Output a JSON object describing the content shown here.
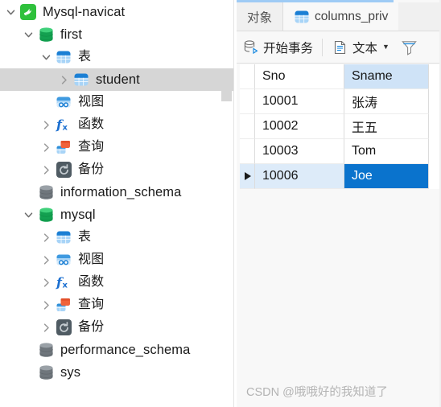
{
  "colors": {
    "selection_blue": "#0a73cd",
    "row_selected_blue": "#ddebf9",
    "header_col_blue": "#cfe3f7",
    "tree_selected_gray": "#d6d6d6",
    "accent_line": "#9ecbf5",
    "mysql_green": "#2fc13c",
    "db_open_green": "#18a04a",
    "db_closed_gray": "#6f767c",
    "table_icon_blue": "#1b7fd4",
    "query_icon_orange": "#f0623a",
    "backup_icon_gray": "#4f5b63"
  },
  "tree": {
    "nodes": [
      {
        "label": "Mysql-navicat",
        "icon": "mysql-dolphin-icon",
        "level": 0,
        "twisty": "down",
        "selected": false,
        "cjk": false
      },
      {
        "label": "first",
        "icon": "database-open-icon",
        "level": 1,
        "twisty": "down",
        "selected": false,
        "cjk": false
      },
      {
        "label": "表",
        "icon": "table-icon",
        "level": 2,
        "twisty": "down",
        "selected": false,
        "cjk": true
      },
      {
        "label": "student",
        "icon": "table-icon",
        "level": 3,
        "twisty": "right",
        "selected": true,
        "cjk": false
      },
      {
        "label": "视图",
        "icon": "view-icon",
        "level": 2,
        "twisty": "none",
        "selected": false,
        "cjk": true
      },
      {
        "label": "函数",
        "icon": "function-icon",
        "level": 2,
        "twisty": "right",
        "selected": false,
        "cjk": true
      },
      {
        "label": "查询",
        "icon": "query-icon",
        "level": 2,
        "twisty": "right",
        "selected": false,
        "cjk": true
      },
      {
        "label": "备份",
        "icon": "backup-icon",
        "level": 2,
        "twisty": "right",
        "selected": false,
        "cjk": true
      },
      {
        "label": "information_schema",
        "icon": "database-closed-icon",
        "level": 1,
        "twisty": "none",
        "selected": false,
        "cjk": false
      },
      {
        "label": "mysql",
        "icon": "database-open-icon",
        "level": 1,
        "twisty": "down",
        "selected": false,
        "cjk": false
      },
      {
        "label": "表",
        "icon": "table-icon",
        "level": 2,
        "twisty": "right",
        "selected": false,
        "cjk": true
      },
      {
        "label": "视图",
        "icon": "view-icon",
        "level": 2,
        "twisty": "right",
        "selected": false,
        "cjk": true
      },
      {
        "label": "函数",
        "icon": "function-icon",
        "level": 2,
        "twisty": "right",
        "selected": false,
        "cjk": true
      },
      {
        "label": "查询",
        "icon": "query-icon",
        "level": 2,
        "twisty": "right",
        "selected": false,
        "cjk": true
      },
      {
        "label": "备份",
        "icon": "backup-icon",
        "level": 2,
        "twisty": "right",
        "selected": false,
        "cjk": true
      },
      {
        "label": "performance_schema",
        "icon": "database-closed-icon",
        "level": 1,
        "twisty": "none",
        "selected": false,
        "cjk": false
      },
      {
        "label": "sys",
        "icon": "database-closed-icon",
        "level": 1,
        "twisty": "none",
        "selected": false,
        "cjk": false
      }
    ]
  },
  "tabs": [
    {
      "label": "对象",
      "icon": "none",
      "active": false
    },
    {
      "label": "columns_priv",
      "icon": "table-icon",
      "active": true
    }
  ],
  "toolbar": {
    "begin_transaction_label": "开始事务",
    "begin_transaction_icon": "database-run-icon",
    "text_label": "文本",
    "text_icon": "document-text-icon",
    "text_caret": "▾",
    "filter_icon": "filter-funnel-icon"
  },
  "grid": {
    "columns": [
      {
        "key": "Sno",
        "label": "Sno",
        "selected": false
      },
      {
        "key": "Sname",
        "label": "Sname",
        "selected": true
      }
    ],
    "rows": [
      {
        "Sno": "10001",
        "Sname": "张涛",
        "selected": false,
        "active_cell": null
      },
      {
        "Sno": "10002",
        "Sname": "王五",
        "selected": false,
        "active_cell": null
      },
      {
        "Sno": "10003",
        "Sname": "Tom",
        "selected": false,
        "active_cell": null
      },
      {
        "Sno": "10006",
        "Sname": "Joe",
        "selected": true,
        "active_cell": "Sname"
      }
    ]
  },
  "watermark": {
    "text": "CSDN @哦哦好的我知道了"
  }
}
